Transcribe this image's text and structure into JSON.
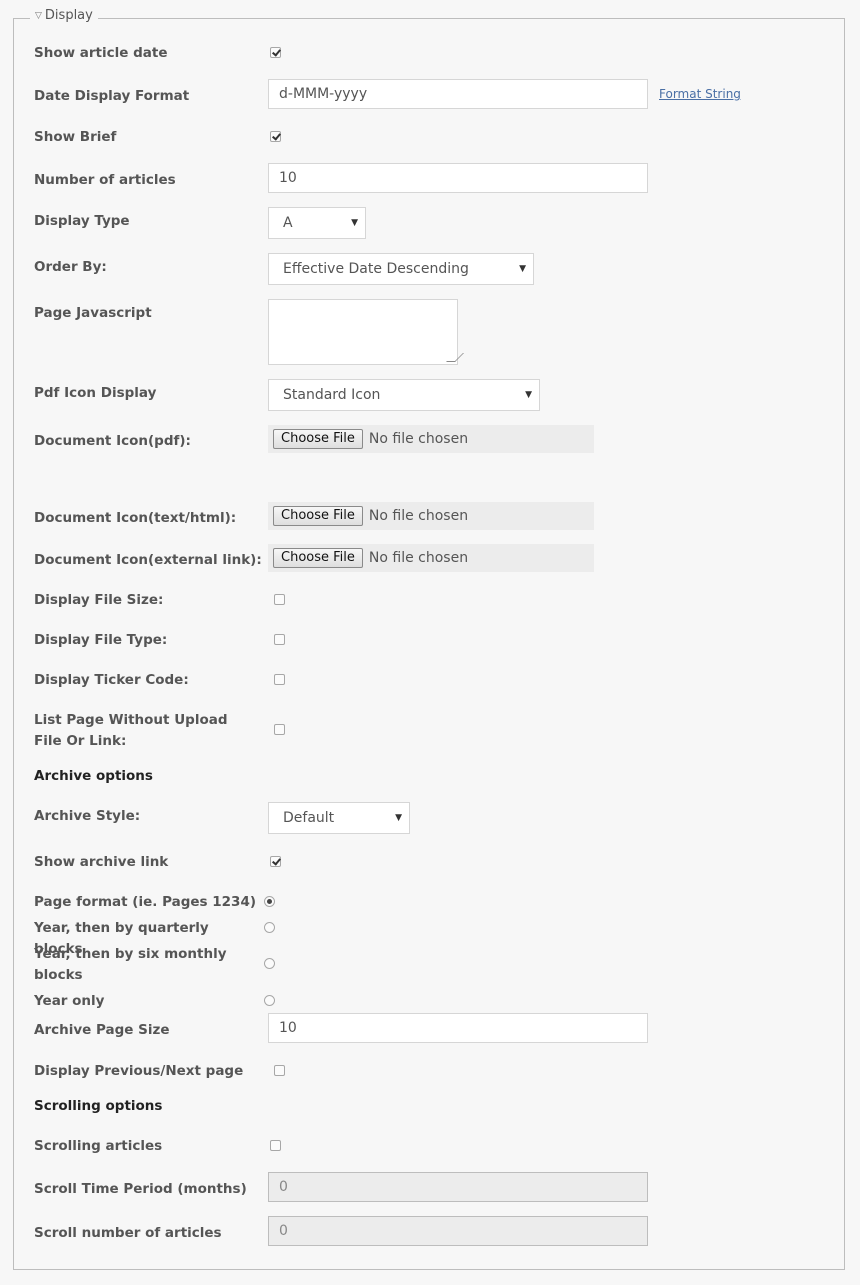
{
  "legend": "Display",
  "fields": {
    "show_article_date": {
      "label": "Show article date",
      "checked": true
    },
    "date_format": {
      "label": "Date Display Format",
      "value": "d-MMM-yyyy",
      "link": "Format String"
    },
    "show_brief": {
      "label": "Show Brief",
      "checked": true
    },
    "number_articles": {
      "label": "Number of articles",
      "value": "10"
    },
    "display_type": {
      "label": "Display Type",
      "value": "A"
    },
    "order_by": {
      "label": "Order By:",
      "value": "Effective Date Descending"
    },
    "page_js": {
      "label": "Page Javascript",
      "value": ""
    },
    "pdf_icon_display": {
      "label": "Pdf Icon Display",
      "value": "Standard Icon"
    },
    "doc_icon_pdf": {
      "label": "Document Icon(pdf):",
      "button": "Choose File",
      "status": "No file chosen"
    },
    "doc_icon_html": {
      "label": "Document Icon(text/html):",
      "button": "Choose File",
      "status": "No file chosen"
    },
    "doc_icon_ext": {
      "label": "Document Icon(external link):",
      "button": "Choose File",
      "status": "No file chosen"
    },
    "display_file_size": {
      "label": "Display File Size:",
      "checked": false
    },
    "display_file_type": {
      "label": "Display File Type:",
      "checked": false
    },
    "display_ticker": {
      "label": "Display Ticker Code:",
      "checked": false
    },
    "list_page": {
      "label": "List Page Without Upload File Or Link:",
      "checked": false
    }
  },
  "archive": {
    "heading": "Archive options",
    "style": {
      "label": "Archive Style:",
      "value": "Default"
    },
    "show_link": {
      "label": "Show archive link",
      "checked": true
    },
    "radios": [
      {
        "label": "Page format (ie. Pages 1234)",
        "checked": true
      },
      {
        "label": "Year, then by quarterly blocks",
        "checked": false
      },
      {
        "label": "Year, then by six monthly blocks",
        "checked": false
      },
      {
        "label": "Year only",
        "checked": false
      }
    ],
    "page_size": {
      "label": "Archive Page Size",
      "value": "10"
    },
    "prev_next": {
      "label": "Display Previous/Next page",
      "checked": false
    }
  },
  "scrolling": {
    "heading": "Scrolling options",
    "articles": {
      "label": "Scrolling articles",
      "checked": false
    },
    "period": {
      "label": "Scroll Time Period (months)",
      "value": "0"
    },
    "number": {
      "label": "Scroll number of articles",
      "value": "0"
    }
  }
}
